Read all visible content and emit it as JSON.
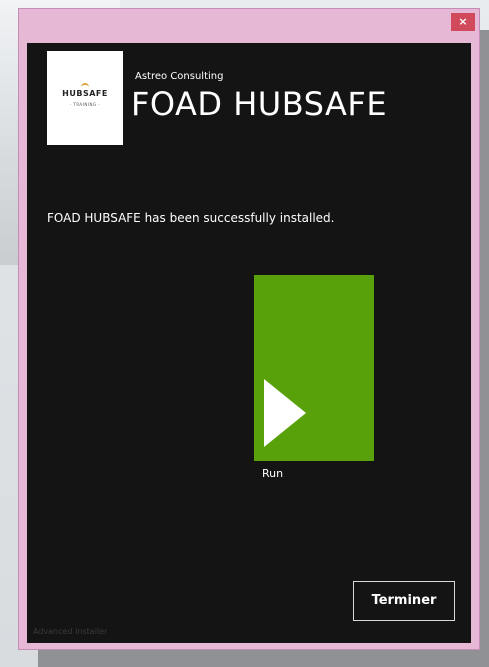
{
  "window": {
    "close_glyph": "×"
  },
  "logo": {
    "wordmark": "HUBSAFE",
    "tagline": "· TRAINING ·"
  },
  "header": {
    "publisher": "Astreo Consulting",
    "title": "FOAD HUBSAFE"
  },
  "main": {
    "status_message": "FOAD HUBSAFE has been successfully installed."
  },
  "run_tile": {
    "label": "Run",
    "icon": "play-icon",
    "color": "#58a10a"
  },
  "footer": {
    "finish_label": "Terminer",
    "credit": "Advanced Installer"
  },
  "colors": {
    "background": "#141414",
    "window_frame": "#e6b8d6",
    "close_button": "#d14a5b",
    "accent_green": "#58a10a"
  }
}
